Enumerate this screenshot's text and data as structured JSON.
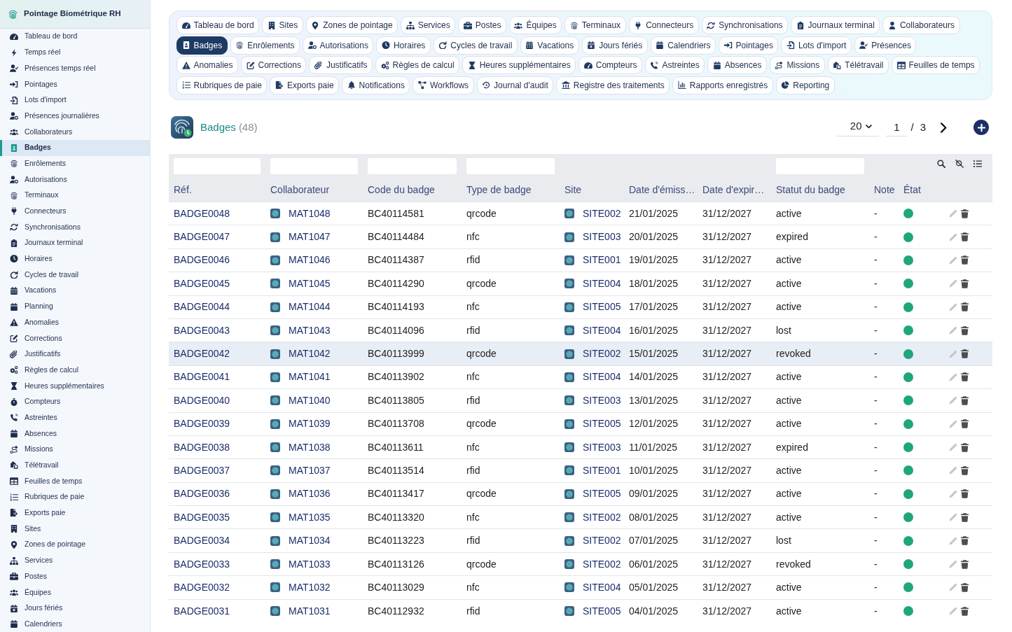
{
  "sidebar": {
    "title": "Pointage Biométrique RH",
    "items": [
      {
        "label": "Tableau de bord",
        "selected": false
      },
      {
        "label": "Temps réel",
        "selected": false
      },
      {
        "label": "Présences temps réel",
        "selected": false
      },
      {
        "label": "Pointages",
        "selected": false
      },
      {
        "label": "Lots d'import",
        "selected": false
      },
      {
        "label": "Présences journalières",
        "selected": false
      },
      {
        "label": "Collaborateurs",
        "selected": false
      },
      {
        "label": "Badges",
        "selected": true
      },
      {
        "label": "Enrôlements",
        "selected": false
      },
      {
        "label": "Autorisations",
        "selected": false
      },
      {
        "label": "Terminaux",
        "selected": false
      },
      {
        "label": "Connecteurs",
        "selected": false
      },
      {
        "label": "Synchronisations",
        "selected": false
      },
      {
        "label": "Journaux terminal",
        "selected": false
      },
      {
        "label": "Horaires",
        "selected": false
      },
      {
        "label": "Cycles de travail",
        "selected": false
      },
      {
        "label": "Vacations",
        "selected": false
      },
      {
        "label": "Planning",
        "selected": false
      },
      {
        "label": "Anomalies",
        "selected": false
      },
      {
        "label": "Corrections",
        "selected": false
      },
      {
        "label": "Justificatifs",
        "selected": false
      },
      {
        "label": "Règles de calcul",
        "selected": false
      },
      {
        "label": "Heures supplémentaires",
        "selected": false
      },
      {
        "label": "Compteurs",
        "selected": false
      },
      {
        "label": "Astreintes",
        "selected": false
      },
      {
        "label": "Absences",
        "selected": false
      },
      {
        "label": "Missions",
        "selected": false
      },
      {
        "label": "Télétravail",
        "selected": false
      },
      {
        "label": "Feuilles de temps",
        "selected": false
      },
      {
        "label": "Rubriques de paie",
        "selected": false
      },
      {
        "label": "Exports paie",
        "selected": false
      },
      {
        "label": "Sites",
        "selected": false
      },
      {
        "label": "Zones de pointage",
        "selected": false
      },
      {
        "label": "Services",
        "selected": false
      },
      {
        "label": "Postes",
        "selected": false
      },
      {
        "label": "Équipes",
        "selected": false
      },
      {
        "label": "Jours fériés",
        "selected": false
      },
      {
        "label": "Calendriers",
        "selected": false
      }
    ]
  },
  "nav_tabs": {
    "rows": [
      {
        "tabs": [
          {
            "label": "Tableau de bord",
            "selected": false
          },
          {
            "label": "Sites",
            "selected": false
          },
          {
            "label": "Zones de pointage",
            "selected": false
          },
          {
            "label": "Services",
            "selected": false
          },
          {
            "label": "Postes",
            "selected": false
          },
          {
            "label": "Équipes",
            "selected": false
          },
          {
            "label": "Terminaux",
            "selected": false
          },
          {
            "label": "Connecteurs",
            "selected": false
          },
          {
            "label": "Synchronisations",
            "selected": false
          },
          {
            "label": "Journaux terminal",
            "selected": false
          },
          {
            "label": "Collaborateurs",
            "selected": false
          }
        ]
      },
      {
        "tabs": [
          {
            "label": "Badges",
            "selected": true
          },
          {
            "label": "Enrôlements",
            "selected": false
          },
          {
            "label": "Autorisations",
            "selected": false
          },
          {
            "label": "Horaires",
            "selected": false
          },
          {
            "label": "Cycles de travail",
            "selected": false
          },
          {
            "label": "Vacations",
            "selected": false
          },
          {
            "label": "Jours fériés",
            "selected": false
          },
          {
            "label": "Calendriers",
            "selected": false
          },
          {
            "label": "Pointages",
            "selected": false
          },
          {
            "label": "Lots d'import",
            "selected": false
          },
          {
            "label": "Présences",
            "selected": false
          }
        ]
      },
      {
        "tabs": [
          {
            "label": "Anomalies",
            "selected": false
          },
          {
            "label": "Corrections",
            "selected": false
          },
          {
            "label": "Justificatifs",
            "selected": false
          },
          {
            "label": "Règles de calcul",
            "selected": false
          },
          {
            "label": "Heures supplémentaires",
            "selected": false
          },
          {
            "label": "Compteurs",
            "selected": false
          },
          {
            "label": "Astreintes",
            "selected": false
          },
          {
            "label": "Absences",
            "selected": false
          },
          {
            "label": "Missions",
            "selected": false
          },
          {
            "label": "Télétravail",
            "selected": false
          },
          {
            "label": "Feuilles de temps",
            "selected": false
          }
        ]
      },
      {
        "tabs": [
          {
            "label": "Rubriques de paie",
            "selected": false
          },
          {
            "label": "Exports paie",
            "selected": false
          },
          {
            "label": "Notifications",
            "selected": false
          },
          {
            "label": "Workflows",
            "selected": false
          },
          {
            "label": "Journal d'audit",
            "selected": false
          },
          {
            "label": "Registre des traitements",
            "selected": false
          },
          {
            "label": "Rapports enregistrés",
            "selected": false
          },
          {
            "label": "Reporting",
            "selected": false
          }
        ]
      }
    ]
  },
  "page_header": {
    "title": "Badges",
    "count": "(48)",
    "page_size": "20",
    "page": "1",
    "page_separator": "/",
    "page_count": "3"
  },
  "table": {
    "columns": [
      {
        "label": "Réf.",
        "filter": true
      },
      {
        "label": "Collaborateur",
        "filter": true
      },
      {
        "label": "Code du badge",
        "filter": true
      },
      {
        "label": "Type de badge",
        "filter": true
      },
      {
        "label": "Site",
        "filter": false
      },
      {
        "label": "Date d'émiss…",
        "filter": false
      },
      {
        "label": "Date d'expir…",
        "filter": false
      },
      {
        "label": "Statut du badge",
        "filter": true
      },
      {
        "label": "Note",
        "filter": false
      },
      {
        "label": "État",
        "filter": false
      }
    ],
    "rows": [
      {
        "ref": "BADGE0048",
        "collaborateur": "MAT1048",
        "code": "BC40114581",
        "type": "qrcode",
        "site": "SITE002",
        "date_emission": "21/01/2025",
        "date_expiration": "31/12/2027",
        "statut": "active",
        "note": "-",
        "enabled": true,
        "selected": false
      },
      {
        "ref": "BADGE0047",
        "collaborateur": "MAT1047",
        "code": "BC40114484",
        "type": "nfc",
        "site": "SITE003",
        "date_emission": "20/01/2025",
        "date_expiration": "31/12/2027",
        "statut": "expired",
        "note": "-",
        "enabled": true,
        "selected": false
      },
      {
        "ref": "BADGE0046",
        "collaborateur": "MAT1046",
        "code": "BC40114387",
        "type": "rfid",
        "site": "SITE001",
        "date_emission": "19/01/2025",
        "date_expiration": "31/12/2027",
        "statut": "active",
        "note": "-",
        "enabled": true,
        "selected": false
      },
      {
        "ref": "BADGE0045",
        "collaborateur": "MAT1045",
        "code": "BC40114290",
        "type": "qrcode",
        "site": "SITE004",
        "date_emission": "18/01/2025",
        "date_expiration": "31/12/2027",
        "statut": "active",
        "note": "-",
        "enabled": true,
        "selected": false
      },
      {
        "ref": "BADGE0044",
        "collaborateur": "MAT1044",
        "code": "BC40114193",
        "type": "nfc",
        "site": "SITE005",
        "date_emission": "17/01/2025",
        "date_expiration": "31/12/2027",
        "statut": "active",
        "note": "-",
        "enabled": true,
        "selected": false
      },
      {
        "ref": "BADGE0043",
        "collaborateur": "MAT1043",
        "code": "BC40114096",
        "type": "rfid",
        "site": "SITE004",
        "date_emission": "16/01/2025",
        "date_expiration": "31/12/2027",
        "statut": "lost",
        "note": "-",
        "enabled": true,
        "selected": false
      },
      {
        "ref": "BADGE0042",
        "collaborateur": "MAT1042",
        "code": "BC40113999",
        "type": "qrcode",
        "site": "SITE002",
        "date_emission": "15/01/2025",
        "date_expiration": "31/12/2027",
        "statut": "revoked",
        "note": "-",
        "enabled": true,
        "selected": true
      },
      {
        "ref": "BADGE0041",
        "collaborateur": "MAT1041",
        "code": "BC40113902",
        "type": "nfc",
        "site": "SITE004",
        "date_emission": "14/01/2025",
        "date_expiration": "31/12/2027",
        "statut": "active",
        "note": "-",
        "enabled": true,
        "selected": false
      },
      {
        "ref": "BADGE0040",
        "collaborateur": "MAT1040",
        "code": "BC40113805",
        "type": "rfid",
        "site": "SITE003",
        "date_emission": "13/01/2025",
        "date_expiration": "31/12/2027",
        "statut": "active",
        "note": "-",
        "enabled": true,
        "selected": false
      },
      {
        "ref": "BADGE0039",
        "collaborateur": "MAT1039",
        "code": "BC40113708",
        "type": "qrcode",
        "site": "SITE005",
        "date_emission": "12/01/2025",
        "date_expiration": "31/12/2027",
        "statut": "active",
        "note": "-",
        "enabled": true,
        "selected": false
      },
      {
        "ref": "BADGE0038",
        "collaborateur": "MAT1038",
        "code": "BC40113611",
        "type": "nfc",
        "site": "SITE003",
        "date_emission": "11/01/2025",
        "date_expiration": "31/12/2027",
        "statut": "expired",
        "note": "-",
        "enabled": true,
        "selected": false
      },
      {
        "ref": "BADGE0037",
        "collaborateur": "MAT1037",
        "code": "BC40113514",
        "type": "rfid",
        "site": "SITE001",
        "date_emission": "10/01/2025",
        "date_expiration": "31/12/2027",
        "statut": "active",
        "note": "-",
        "enabled": true,
        "selected": false
      },
      {
        "ref": "BADGE0036",
        "collaborateur": "MAT1036",
        "code": "BC40113417",
        "type": "qrcode",
        "site": "SITE005",
        "date_emission": "09/01/2025",
        "date_expiration": "31/12/2027",
        "statut": "active",
        "note": "-",
        "enabled": true,
        "selected": false
      },
      {
        "ref": "BADGE0035",
        "collaborateur": "MAT1035",
        "code": "BC40113320",
        "type": "nfc",
        "site": "SITE002",
        "date_emission": "08/01/2025",
        "date_expiration": "31/12/2027",
        "statut": "active",
        "note": "-",
        "enabled": true,
        "selected": false
      },
      {
        "ref": "BADGE0034",
        "collaborateur": "MAT1034",
        "code": "BC40113223",
        "type": "rfid",
        "site": "SITE002",
        "date_emission": "07/01/2025",
        "date_expiration": "31/12/2027",
        "statut": "lost",
        "note": "-",
        "enabled": true,
        "selected": false
      },
      {
        "ref": "BADGE0033",
        "collaborateur": "MAT1033",
        "code": "BC40113126",
        "type": "qrcode",
        "site": "SITE002",
        "date_emission": "06/01/2025",
        "date_expiration": "31/12/2027",
        "statut": "revoked",
        "note": "-",
        "enabled": true,
        "selected": false
      },
      {
        "ref": "BADGE0032",
        "collaborateur": "MAT1032",
        "code": "BC40113029",
        "type": "nfc",
        "site": "SITE004",
        "date_emission": "05/01/2025",
        "date_expiration": "31/12/2027",
        "statut": "active",
        "note": "-",
        "enabled": true,
        "selected": false
      },
      {
        "ref": "BADGE0031",
        "collaborateur": "MAT1031",
        "code": "BC40112932",
        "type": "rfid",
        "site": "SITE005",
        "date_emission": "04/01/2025",
        "date_expiration": "31/12/2027",
        "statut": "active",
        "note": "-",
        "enabled": true,
        "selected": false
      }
    ]
  }
}
